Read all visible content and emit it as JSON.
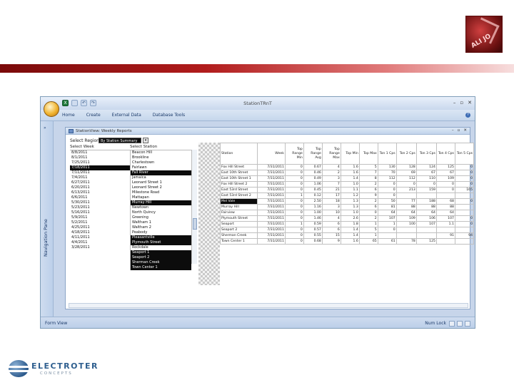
{
  "slide": {
    "brand_logo_text": "ALI JO",
    "company": {
      "name": "ELECTROTER",
      "tagline": "CONCEPTS"
    }
  },
  "app": {
    "window_title": "StationTRnT",
    "quick_access_icons": [
      "excel-icon",
      "save-icon",
      "undo-icon",
      "redo-icon"
    ],
    "ribbon_tabs": [
      "Home",
      "Create",
      "External Data",
      "Database Tools"
    ],
    "nav_pane_label": "Navigation Pane",
    "status_left": "Form View",
    "status_right": "Num Lock"
  },
  "form": {
    "title": "StationView: Weekly Reports",
    "select_label": "Select Region:",
    "select_value": "By Station Summary",
    "week_header": "Select Week",
    "station_header": "Select Station",
    "weeks": [
      "8/8/2011",
      "8/1/2011",
      "7/25/2011",
      "7/18/2011",
      "7/11/2011",
      "7/4/2011",
      "6/27/2011",
      "6/20/2011",
      "6/13/2011",
      "6/6/2011",
      "5/30/2011",
      "5/23/2011",
      "5/16/2011",
      "5/9/2011",
      "5/2/2011",
      "4/25/2011",
      "4/18/2011",
      "4/11/2011",
      "4/4/2011",
      "3/28/2011"
    ],
    "stations": [
      "Beacon Hill",
      "Brookline",
      "Charlestown",
      "Fairlawn",
      "Fall River",
      "Jamaica",
      "Leonard Street 1",
      "Leonard Street 2",
      "Milestone Road",
      "Mattapan",
      "Murray Hill",
      "Newtown",
      "North Quincy",
      "Greening",
      "Waltham 1",
      "Waltham 2",
      "Peabody",
      "Pleasantville",
      "Plymouth Street",
      "Rockdale",
      "Seaport 1",
      "Seaport 2",
      "Sherman Creek",
      "Town Center 1"
    ],
    "grid": {
      "headers": [
        "Station",
        "Week",
        "Top Range Min",
        "Top Range Avg",
        "Top Range Max",
        "Top Min",
        "Top Max",
        "Ton 1 Cps",
        "Ton 2 Cps",
        "Ton 3 Cps",
        "Ton 4 Cps",
        "Ton 5 Cps"
      ],
      "rows": [
        [
          "Fox Hill Street",
          "7/31/2011",
          "0",
          "0.67",
          "4",
          "1.6",
          "5",
          "130",
          "128",
          "124",
          "125",
          "0"
        ],
        [
          "East 10th Street",
          "7/31/2011",
          "0",
          "0.46",
          "2",
          "1.6",
          "7",
          "70",
          "69",
          "67",
          "67",
          "0"
        ],
        [
          "East 10th Street 1",
          "7/31/2011",
          "0",
          "0.49",
          "3",
          "1.4",
          "8",
          "112",
          "112",
          "110",
          "109",
          "0"
        ],
        [
          "Fox Hill Street 2",
          "7/31/2011",
          "0",
          "1.06",
          "7",
          "1.0",
          "2",
          "0",
          "0",
          "0",
          "0",
          "0"
        ],
        [
          "East 53rd Street",
          "7/31/2011",
          "0",
          "0.45",
          "21",
          "1.1",
          "6",
          "0",
          "213",
          "159",
          "0",
          "165"
        ],
        [
          "East 53rd Street 2",
          "7/31/2011",
          "1",
          "0.12",
          "17",
          "1.2",
          "9",
          "0",
          "",
          "",
          "",
          ""
        ],
        [
          "Mel Vale",
          "7/31/2011",
          "0",
          "2.50",
          "18",
          "1.3",
          "2",
          "50",
          "77",
          "188",
          "68",
          "0"
        ],
        [
          "Murray Hill",
          "7/31/2011",
          "0",
          "1.16",
          "3",
          "1.3",
          "6",
          "81",
          "88",
          "88",
          "88",
          ""
        ],
        [
          "Fairview",
          "7/31/2011",
          "0",
          "1.00",
          "10",
          "1.0",
          "0",
          "64",
          "64",
          "64",
          "64",
          ""
        ],
        [
          "Plymouth Street",
          "7/31/2011",
          "0",
          "1.46",
          "4",
          "2.6",
          "2",
          "107",
          "109",
          "106",
          "107",
          "0"
        ],
        [
          "Seaport",
          "7/31/2011",
          "1",
          "0.59",
          "6",
          "1.8",
          "1",
          "1",
          "100",
          "107",
          "1.1",
          "0"
        ],
        [
          "Seaport 2",
          "7/31/2011",
          "0",
          "0.57",
          "6",
          "1.4",
          "5",
          "0",
          "",
          "",
          "",
          ""
        ],
        [
          "Sherman Creek",
          "7/31/2011",
          "0",
          "0.55",
          "15",
          "1.4",
          "1",
          "",
          "",
          "",
          "91",
          "94"
        ],
        [
          "Town Center 1",
          "7/31/2011",
          "0",
          "0.68",
          "9",
          "1.6",
          "65",
          "61",
          "78",
          "125",
          "",
          ""
        ]
      ]
    }
  }
}
